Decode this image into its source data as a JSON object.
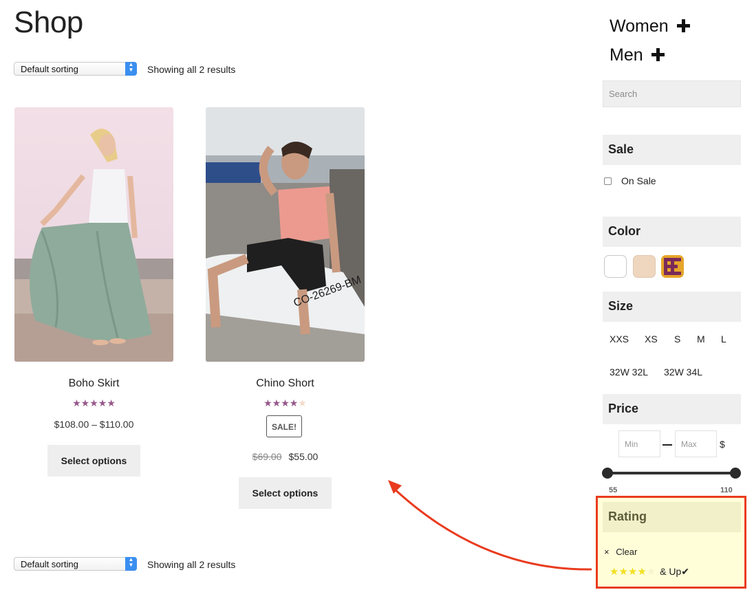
{
  "page": {
    "title": "Shop"
  },
  "toolbar_top": {
    "sort_label": "Default sorting",
    "result_count": "Showing all 2 results"
  },
  "toolbar_bottom": {
    "sort_label": "Default sorting",
    "result_count": "Showing all 2 results"
  },
  "products": [
    {
      "name": "Boho Skirt",
      "rating": 5,
      "rating_max": 5,
      "price": "$108.00 – $110.00",
      "button": "Select options"
    },
    {
      "name": "Chino Short",
      "rating": 4,
      "rating_max": 5,
      "sale_badge": "SALE!",
      "old_price": "$69.00",
      "price": "$55.00",
      "button": "Select options"
    }
  ],
  "sidebar": {
    "categories": [
      {
        "label": "Women",
        "icon": "plus-icon"
      },
      {
        "label": "Men",
        "icon": "plus-icon"
      }
    ],
    "search_placeholder": "Search",
    "sale": {
      "title": "Sale",
      "option": "On Sale"
    },
    "color": {
      "title": "Color",
      "swatches": [
        "#ffffff",
        "#efd6be",
        "pattern-maroon-gold"
      ]
    },
    "size": {
      "title": "Size",
      "options": [
        "XXS",
        "XS",
        "S",
        "M",
        "L",
        "32W 32L",
        "32W 34L"
      ]
    },
    "price": {
      "title": "Price",
      "min_placeholder": "Min",
      "max_placeholder": "Max",
      "currency": "$",
      "range_min": "55",
      "range_max": "110"
    },
    "rating": {
      "title": "Rating",
      "clear_icon": "×",
      "clear_label": "Clear",
      "stars": 4,
      "stars_max": 5,
      "up_label": "& Up",
      "check_icon": "✔"
    }
  },
  "colors": {
    "accent_purple": "#96588a",
    "highlight_border": "#e93b1e",
    "arrow": "#e93b1e",
    "highlight_bg": "#fffed8"
  }
}
